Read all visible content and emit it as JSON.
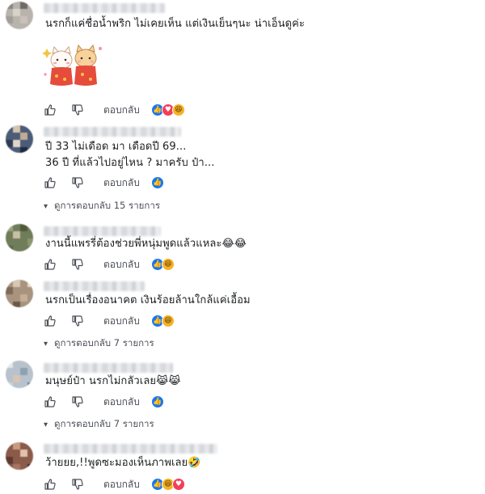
{
  "colors": {
    "like_blue": "#1877f2",
    "love_red": "#f33e58",
    "haha_yellow": "#f7b125",
    "text": "#1c1e21",
    "secondary_text": "#4b4f56"
  },
  "icons": {
    "like": "thumbs-up-icon",
    "dislike": "thumbs-down-icon",
    "reply_arrow": "reply-arrow-icon"
  },
  "comments": [
    {
      "text_lines": [
        "นรกก็แค่ชื่อน้ำพริก ไม่เคยเห็น แต่เงินเย็นๆนะ น่าเอ็นดูค่ะ"
      ],
      "has_sticker": true,
      "reply_label": "ตอบกลับ",
      "reactions": [
        "like",
        "love",
        "haha"
      ],
      "view_replies": ""
    },
    {
      "text_lines": [
        "ปี 33 ไม่เดือด มา เดือดปี 69...",
        "36 ปี ที่แล้วไปอยู่ไหน ? มาครับ ป๋า..."
      ],
      "has_sticker": false,
      "reply_label": "ตอบกลับ",
      "reactions": [
        "like"
      ],
      "view_replies": "ดูการตอบกลับ 15 รายการ"
    },
    {
      "text_lines": [
        "งานนี้แพรรี่ต้องช่วยพี่หนุ่มพูดแล้วแหละ😂😂"
      ],
      "has_sticker": false,
      "reply_label": "ตอบกลับ",
      "reactions": [
        "like",
        "haha"
      ],
      "view_replies": ""
    },
    {
      "text_lines": [
        "นรกเป็นเรื่องอนาคต เงินร้อยล้านใกล้แค่เอื้อม"
      ],
      "has_sticker": false,
      "reply_label": "ตอบกลับ",
      "reactions": [
        "like",
        "haha"
      ],
      "view_replies": "ดูการตอบกลับ 7 รายการ"
    },
    {
      "text_lines": [
        "มนุษย์ป๋า นรกไม่กลัวเลย😹😹"
      ],
      "has_sticker": false,
      "reply_label": "ตอบกลับ",
      "reactions": [
        "like"
      ],
      "view_replies": "ดูการตอบกลับ 7 รายการ"
    },
    {
      "text_lines": [
        "ว้ายยย,!!พูดซะมองเห็นภาพเลย🤣"
      ],
      "has_sticker": false,
      "reply_label": "ตอบกลับ",
      "reactions": [
        "like",
        "haha",
        "love"
      ],
      "view_replies": ""
    }
  ]
}
